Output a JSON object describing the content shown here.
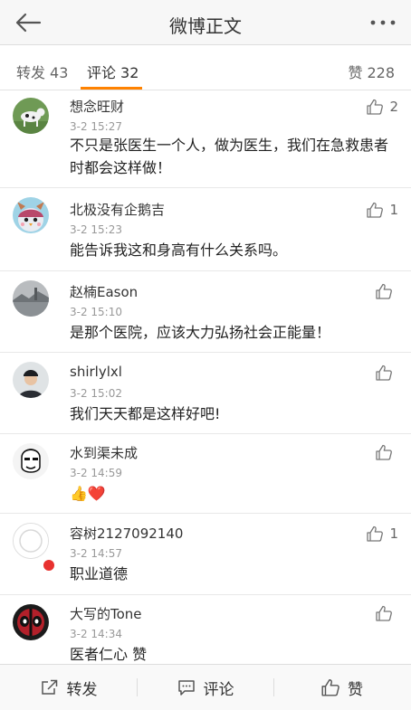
{
  "header": {
    "title": "微博正文"
  },
  "tabs": {
    "repost_label": "转发",
    "repost_count": "43",
    "comment_label": "评论",
    "comment_count": "32",
    "like_label": "赞",
    "like_count": "228"
  },
  "comments": [
    {
      "name": "想念旺财",
      "time": "3-2 15:27",
      "text": "不只是张医生一个人，做为医生，我们在急救患者时都会这样做！",
      "likes": "2"
    },
    {
      "name": "北极没有企鹅吉",
      "time": "3-2 15:23",
      "text": "能告诉我这和身高有什么关系吗。",
      "likes": "1"
    },
    {
      "name": "赵楠Eason",
      "time": "3-2 15:10",
      "text": "是那个医院，应该大力弘扬社会正能量！",
      "likes": ""
    },
    {
      "name": "shirlylxl",
      "time": "3-2 15:02",
      "text": "我们天天都是这样好吧!",
      "likes": ""
    },
    {
      "name": "水到渠未成",
      "time": "3-2 14:59",
      "text": "👍❤️",
      "likes": ""
    },
    {
      "name": "容树2127092140",
      "time": "3-2 14:57",
      "text": "职业道德",
      "likes": "1"
    },
    {
      "name": "大写的Tone",
      "time": "3-2 14:34",
      "text": "医者仁心 赞",
      "likes": ""
    }
  ],
  "bottom": {
    "repost": "转发",
    "comment": "评论",
    "like": "赞"
  },
  "colors": {
    "accent": "#ff8200",
    "badge": "#e8312f"
  }
}
